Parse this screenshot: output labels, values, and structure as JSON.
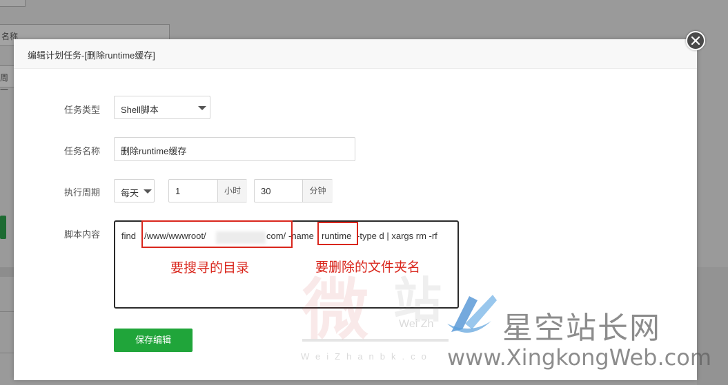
{
  "background": {
    "input1_text": "名称",
    "input2_text": "周一"
  },
  "modal": {
    "title": "编辑计划任务-[删除runtime缓存]"
  },
  "form": {
    "task_type": {
      "label": "任务类型",
      "value": "Shell脚本"
    },
    "task_name": {
      "label": "任务名称",
      "value": "删除runtime缓存"
    },
    "cycle": {
      "label": "执行周期",
      "period": "每天",
      "hour_value": "1",
      "hour_unit": "小时",
      "minute_value": "30",
      "minute_unit": "分钟"
    },
    "script": {
      "label": "脚本内容",
      "seg_find": "find ",
      "seg_path": "/www/wwwroot/",
      "seg_domain_tail": "com/",
      "seg_name_flag": " -name ",
      "seg_target": "runtime",
      "seg_rest": " -type d  | xargs rm -rf"
    },
    "save_label": "保存编辑"
  },
  "annotations": {
    "dir_note": "要搜寻的目录",
    "folder_note": "要删除的文件夹名"
  },
  "watermarks": {
    "char1": "微",
    "char2": "站",
    "weizh": "Wei Zh",
    "weizhanbk": "WeiZhanbk.co",
    "site_cn": "星空站长网",
    "site_en": "www.XingkongWeb.com"
  }
}
